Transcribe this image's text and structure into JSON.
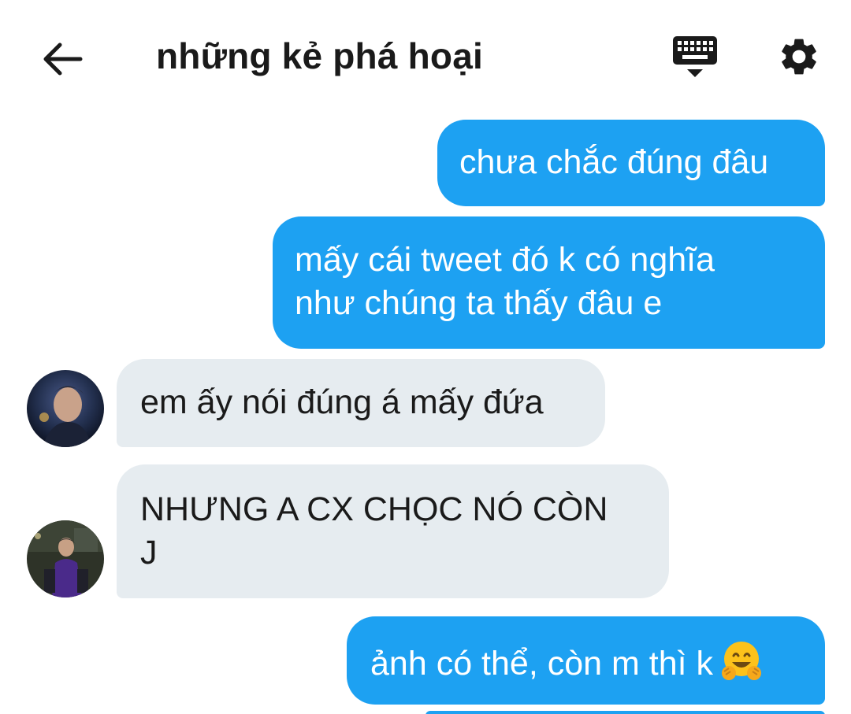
{
  "header": {
    "title": "những kẻ phá hoại",
    "back_icon": "arrow-left-icon",
    "keyboard_icon": "keyboard-icon",
    "settings_icon": "gear-icon"
  },
  "colors": {
    "outgoing_bubble": "#1da1f2",
    "incoming_bubble": "#e6ecf0",
    "text_dark": "#1a1a1a"
  },
  "messages": [
    {
      "direction": "outgoing",
      "lines": [
        "chưa chắc đúng đâu"
      ]
    },
    {
      "direction": "outgoing",
      "lines": [
        "mấy cái tweet đó k có nghĩa",
        "như chúng ta thấy đâu e"
      ]
    },
    {
      "direction": "incoming",
      "lines": [
        "em ấy nói đúng á mấy đứa"
      ],
      "avatar": "avatar-icon"
    },
    {
      "direction": "incoming",
      "lines": [
        "NHƯNG A CX CHỌC NÓ CÒN",
        "J"
      ],
      "avatar": "avatar-icon"
    },
    {
      "direction": "outgoing",
      "lines": [
        "ảnh có thể, còn m thì k"
      ],
      "emoji": "hugging-face-icon"
    }
  ]
}
